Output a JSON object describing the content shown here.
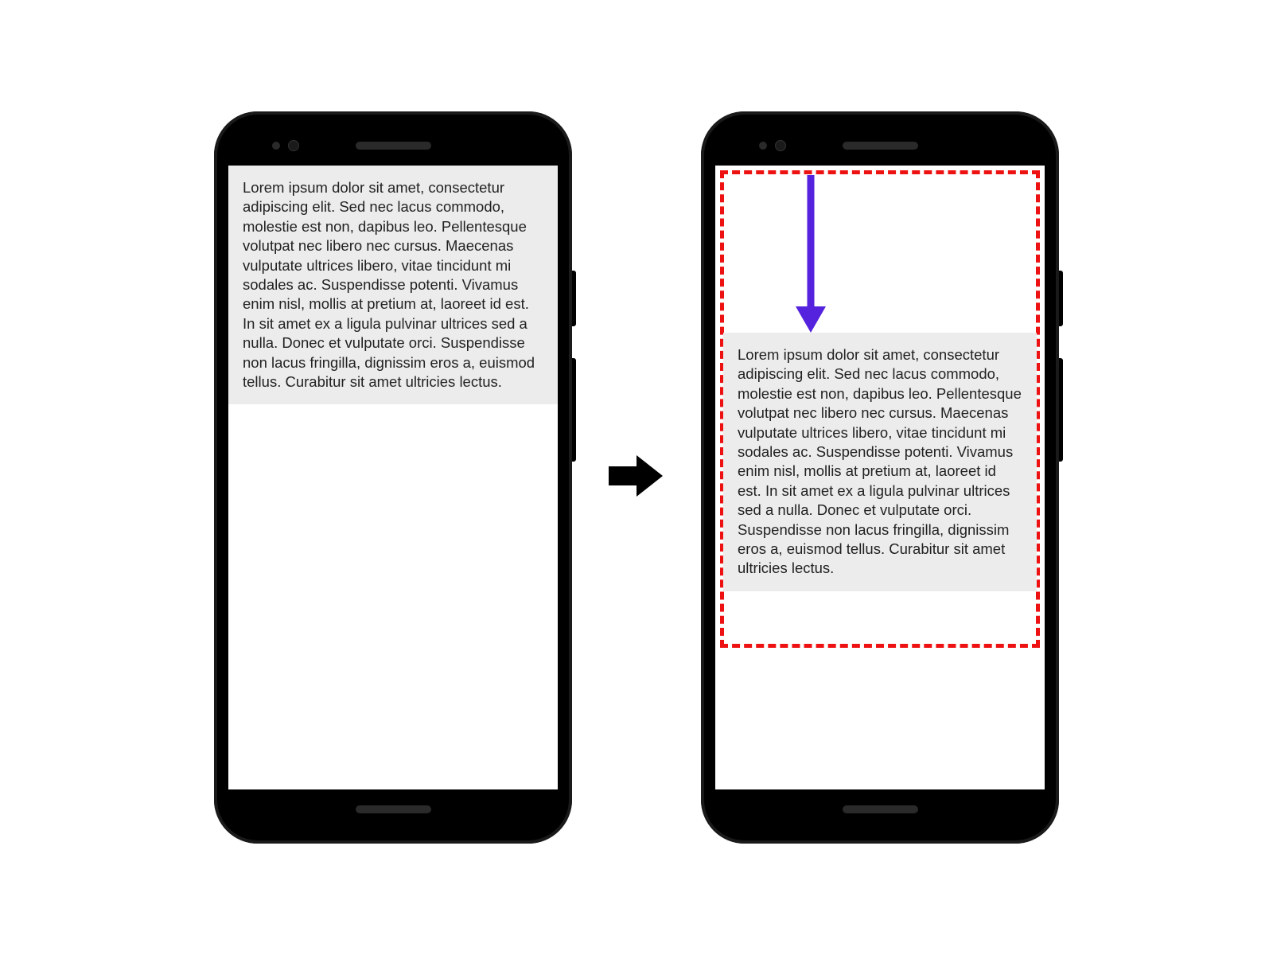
{
  "paragraph": "Lorem ipsum dolor sit amet, consectetur adipiscing elit. Sed nec lacus commodo, molestie est non, dapibus leo. Pellentesque volutpat nec libero nec cursus. Maecenas vulputate ultrices libero, vitae tincidunt mi sodales ac. Suspendisse potenti. Vivamus enim nisl, mollis at pretium at, laoreet id est. In sit amet ex a ligula pulvinar ultrices sed a nulla. Donec et vulputate orci. Suspendisse non lacus fringilla, dignissim eros a, euismod tellus. Curabitur sit amet ultricies lectus.",
  "colors": {
    "highlight_border": "#ee1111",
    "arrow_down": "#5522dd",
    "transition_arrow": "#000000",
    "text_bg": "#ececec"
  }
}
